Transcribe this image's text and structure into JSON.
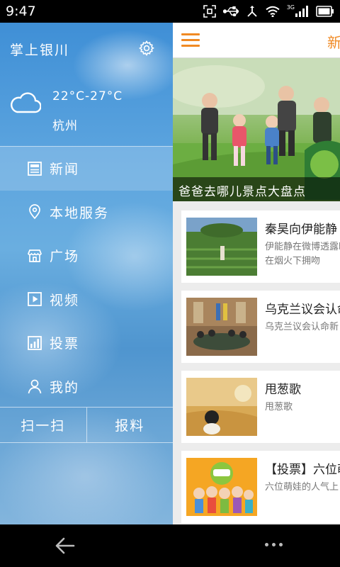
{
  "status_bar": {
    "time": "9:47",
    "network_label": "3G"
  },
  "drawer": {
    "title": "掌上银川",
    "weather": {
      "temperature": "22°C-27°C",
      "city": "杭州"
    },
    "menu": [
      {
        "label": "新闻",
        "icon": "news-icon",
        "active": true
      },
      {
        "label": "本地服务",
        "icon": "location-pin-icon",
        "active": false
      },
      {
        "label": "广场",
        "icon": "store-icon",
        "active": false
      },
      {
        "label": "视频",
        "icon": "play-icon",
        "active": false
      },
      {
        "label": "投票",
        "icon": "bar-chart-icon",
        "active": false
      },
      {
        "label": "我的",
        "icon": "user-icon",
        "active": false
      }
    ],
    "bottom_buttons": {
      "scan": "扫一扫",
      "report": "报料"
    }
  },
  "main": {
    "appbar_title": "新",
    "banner_caption": "爸爸去哪儿景点大盘点",
    "articles": [
      {
        "title": "秦昊向伊能静",
        "summary": "伊能静在微博透露晒出在烟火下拥吻"
      },
      {
        "title": "乌克兰议会认命",
        "summary": "乌克兰议会认命新"
      },
      {
        "title": "甩葱歌",
        "summary": "甩葱歌"
      },
      {
        "title": "【投票】六位萌",
        "summary": "六位萌娃的人气上"
      }
    ]
  },
  "colors": {
    "accent": "#f08a24",
    "drawer_blue": "#4f95cf"
  }
}
